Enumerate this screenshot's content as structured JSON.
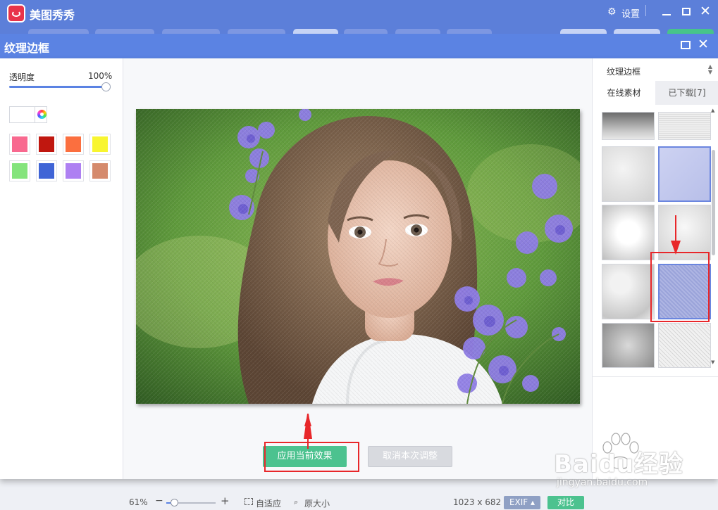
{
  "app": {
    "title": "美图秀秀",
    "settings_label": "设置"
  },
  "dialog": {
    "title": "纹理边框"
  },
  "left_panel": {
    "opacity_label": "透明度",
    "opacity_value": "100%",
    "opacity_level_percent": 100,
    "swatches": [
      "#f8698f",
      "#c0170f",
      "#fb6f3f",
      "#f8f530",
      "#84e47c",
      "#3f64d6",
      "#ae80f2",
      "#d58a6c"
    ]
  },
  "canvas": {
    "apply_label": "应用当前效果",
    "cancel_label": "取消本次调整"
  },
  "right_panel": {
    "category": "纹理边框",
    "tabs": [
      {
        "label": "在线素材",
        "active": true
      },
      {
        "label": "已下载[7]",
        "active": false
      }
    ]
  },
  "status_bar": {
    "zoom": "61%",
    "fit_label": "自适应",
    "actual_size_label": "原大小",
    "dimensions": "1023 x 682",
    "exif_label": "EXIF ▴",
    "compare_label": "对比"
  },
  "watermark": {
    "brand": "Baidu经验",
    "site": "jingyan.baidu.com"
  },
  "colors": {
    "app_bar": "#5c7fd9",
    "dialog_header": "#5b83e3",
    "apply_green": "#4cc28f",
    "annotation_red": "#e8272a"
  }
}
